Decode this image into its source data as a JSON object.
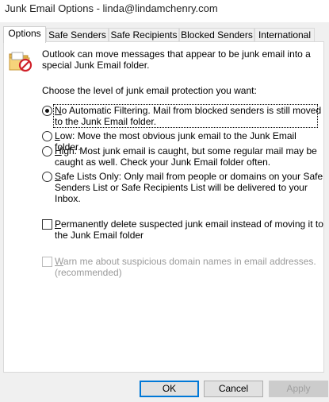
{
  "window": {
    "title": "Junk Email Options - linda@lindamchenry.com"
  },
  "tabs": [
    {
      "label": "Options",
      "active": true
    },
    {
      "label": "Safe Senders"
    },
    {
      "label": "Safe Recipients"
    },
    {
      "label": "Blocked Senders"
    },
    {
      "label": "International"
    }
  ],
  "intro": {
    "icon": "junk-folder-icon",
    "line1": "Outlook can move messages that appear to be junk email into a",
    "line2": "special Junk Email folder."
  },
  "protection_heading": "Choose the level of junk email protection you want:",
  "levels": [
    {
      "key": "N",
      "rest_line1": "o Automatic Filtering. Mail from blocked senders is still moved",
      "line2": "to the Junk Email folder.",
      "selected": true
    },
    {
      "key": "L",
      "rest_line1": "ow: Move the most obvious junk email to the Junk Email folder.",
      "selected": false
    },
    {
      "key": "H",
      "rest_line1": "igh: Most junk email is caught, but some regular mail may be",
      "line2": "caught as well. Check your Junk Email folder often.",
      "selected": false
    },
    {
      "key": "S",
      "rest_line1": "afe Lists Only: Only mail from people or domains on your Safe",
      "line2": "Senders List or Safe Recipients List will be delivered to your",
      "line3": "Inbox.",
      "selected": false
    }
  ],
  "permanent_delete": {
    "key": "P",
    "rest_line1": "ermanently delete suspected junk email instead of moving it to",
    "line2": "the Junk Email folder",
    "checked": false
  },
  "warn_suspicious": {
    "key": "W",
    "rest_line1": "arn me about suspicious domain names in email addresses.",
    "line2": "(recommended)",
    "checked": false,
    "disabled": true
  },
  "buttons": {
    "ok": "OK",
    "cancel": "Cancel",
    "apply": "Apply"
  }
}
